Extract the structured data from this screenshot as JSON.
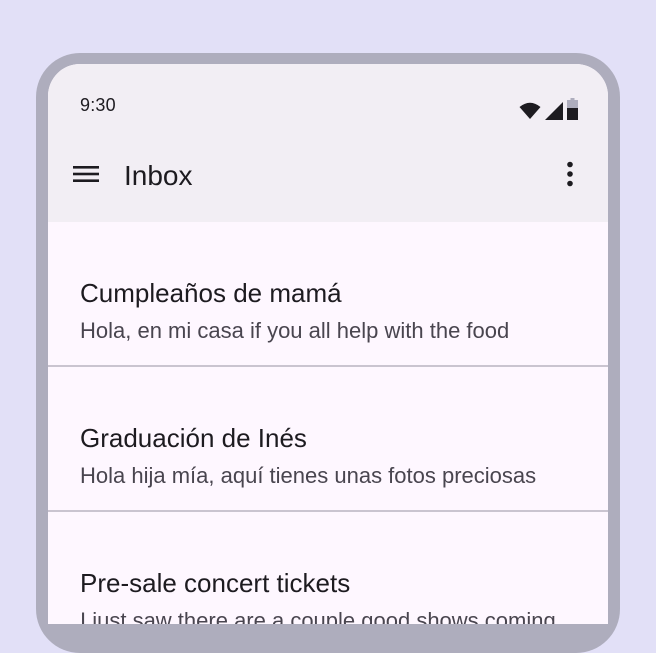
{
  "status_bar": {
    "time": "9:30",
    "icons": [
      "wifi-icon",
      "cellular-signal-icon",
      "battery-icon"
    ]
  },
  "app_bar": {
    "title": "Inbox",
    "leading_icon": "menu-icon",
    "trailing_icon": "more-vert-icon"
  },
  "messages": [
    {
      "subject": "Cumpleaños de mamá",
      "preview": "Hola, en mi casa if you all help with the food"
    },
    {
      "subject": "Graduación de Inés",
      "preview": "Hola hija mía, aquí tienes unas fotos preciosas"
    },
    {
      "subject": "Pre-sale concert tickets",
      "preview": "I just saw there are a couple good shows coming"
    }
  ],
  "colors": {
    "page_background": "#e2e0f7",
    "device_frame": "#aeadbd",
    "top_app_bar": "#f2eef4",
    "surface": "#fef7ff",
    "on_surface": "#1d1b20",
    "on_surface_variant": "#49454f",
    "divider": "#cac4d0"
  }
}
